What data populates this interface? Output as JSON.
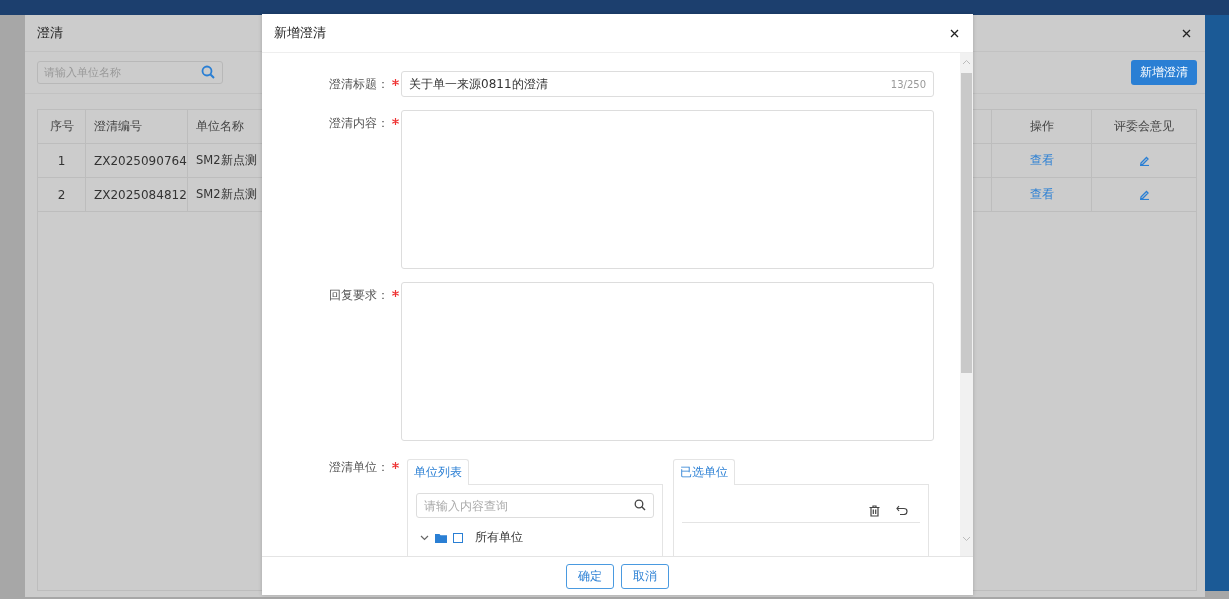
{
  "background_dialog": {
    "title": "澄清",
    "search": {
      "placeholder": "请输入单位名称"
    },
    "add_button": "新增澄清",
    "table": {
      "columns": [
        "序号",
        "澄清编号",
        "单位名称",
        "操作",
        "评委会意见"
      ],
      "rows": [
        {
          "index": "1",
          "code": "ZX2025090764",
          "unit": "SM2新点测",
          "action": "查看"
        },
        {
          "index": "2",
          "code": "ZX2025084812",
          "unit": "SM2新点测",
          "action": "查看"
        }
      ]
    }
  },
  "dialog": {
    "title": "新增澄清",
    "fields": [
      {
        "kind": "input",
        "label": "澄清标题：",
        "required": true,
        "value": "关于单一来源0811的澄清",
        "counter": "13/250"
      },
      {
        "kind": "textarea",
        "label": "澄清内容：",
        "required": true
      },
      {
        "kind": "textarea",
        "label": "回复要求：",
        "required": true
      },
      {
        "kind": "units",
        "label": "澄清单位：",
        "required": true,
        "list_tab": "单位列表",
        "search_placeholder": "请输入内容查询",
        "tree": [
          {
            "label": "所有单位",
            "expanded": true,
            "checked": false
          }
        ],
        "selected_tab": "已选单位"
      }
    ],
    "buttons": [
      "确定",
      "取消"
    ]
  }
}
